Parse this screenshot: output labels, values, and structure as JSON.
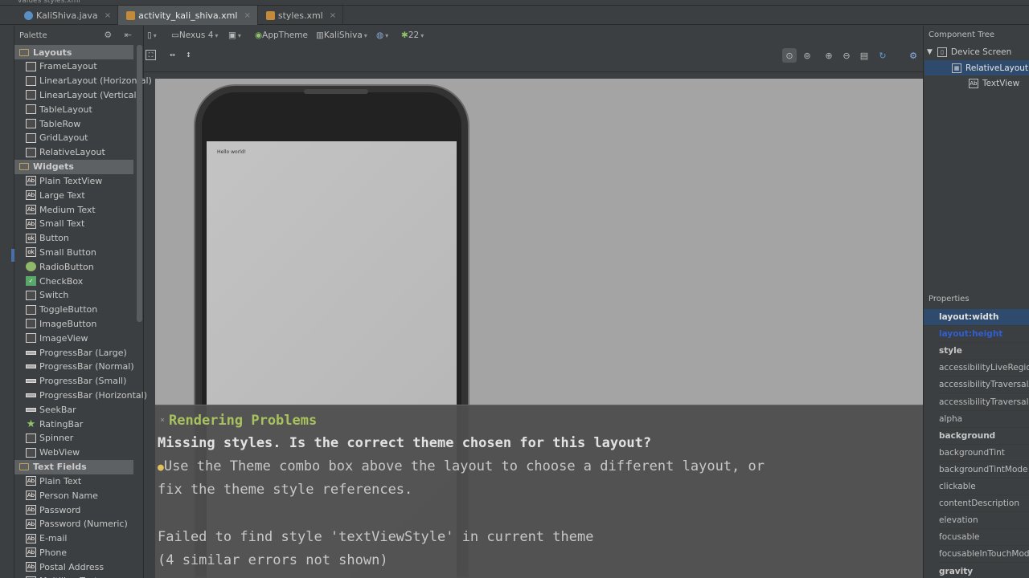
{
  "breadcrumb": {
    "text": "values  styles.xml"
  },
  "tabs": [
    {
      "label": "KaliShiva.java",
      "type": "java"
    },
    {
      "label": "activity_kali_shiva.xml",
      "type": "xml"
    },
    {
      "label": "styles.xml",
      "type": "xml"
    }
  ],
  "palette": {
    "title": "Palette",
    "categories": [
      {
        "name": "Layouts",
        "items": [
          "FrameLayout",
          "LinearLayout (Horizontal)",
          "LinearLayout (Vertical)",
          "TableLayout",
          "TableRow",
          "GridLayout",
          "RelativeLayout"
        ]
      },
      {
        "name": "Widgets",
        "items": [
          "Plain TextView",
          "Large Text",
          "Medium Text",
          "Small Text",
          "Button",
          "Small Button",
          "RadioButton",
          "CheckBox",
          "Switch",
          "ToggleButton",
          "ImageButton",
          "ImageView",
          "ProgressBar (Large)",
          "ProgressBar (Normal)",
          "ProgressBar (Small)",
          "ProgressBar (Horizontal)",
          "SeekBar",
          "RatingBar",
          "Spinner",
          "WebView"
        ]
      },
      {
        "name": "Text Fields",
        "items": [
          "Plain Text",
          "Person Name",
          "Password",
          "Password (Numeric)",
          "E-mail",
          "Phone",
          "Postal Address",
          "Multiline Text"
        ]
      }
    ]
  },
  "toolbar": {
    "device": "Nexus 4",
    "theme": "AppTheme",
    "activity": "KaliShiva",
    "api": "22"
  },
  "canvas": {
    "hello_text": "Hello world!"
  },
  "problems": {
    "title": "Rendering Problems",
    "close": "×",
    "line1": "Missing styles. Is the correct theme chosen for this layout?",
    "line2": "Use the Theme combo box above the layout to choose a different layout, or",
    "line3": "fix the theme style references.",
    "line4": "Failed to find style 'textViewStyle' in current theme",
    "line5": "(4 similar errors not shown)"
  },
  "component_tree": {
    "title": "Component Tree",
    "nodes": [
      "Device Screen",
      "RelativeLayout",
      "TextView"
    ]
  },
  "properties": {
    "title": "Properties",
    "rows": [
      "layout:width",
      "layout:height",
      "style",
      "accessibilityLiveRegion",
      "accessibilityTraversalAfter",
      "accessibilityTraversalBefore",
      "alpha",
      "background",
      "backgroundTint",
      "backgroundTintMode",
      "clickable",
      "contentDescription",
      "elevation",
      "focusable",
      "focusableInTouchMode",
      "gravity"
    ]
  }
}
